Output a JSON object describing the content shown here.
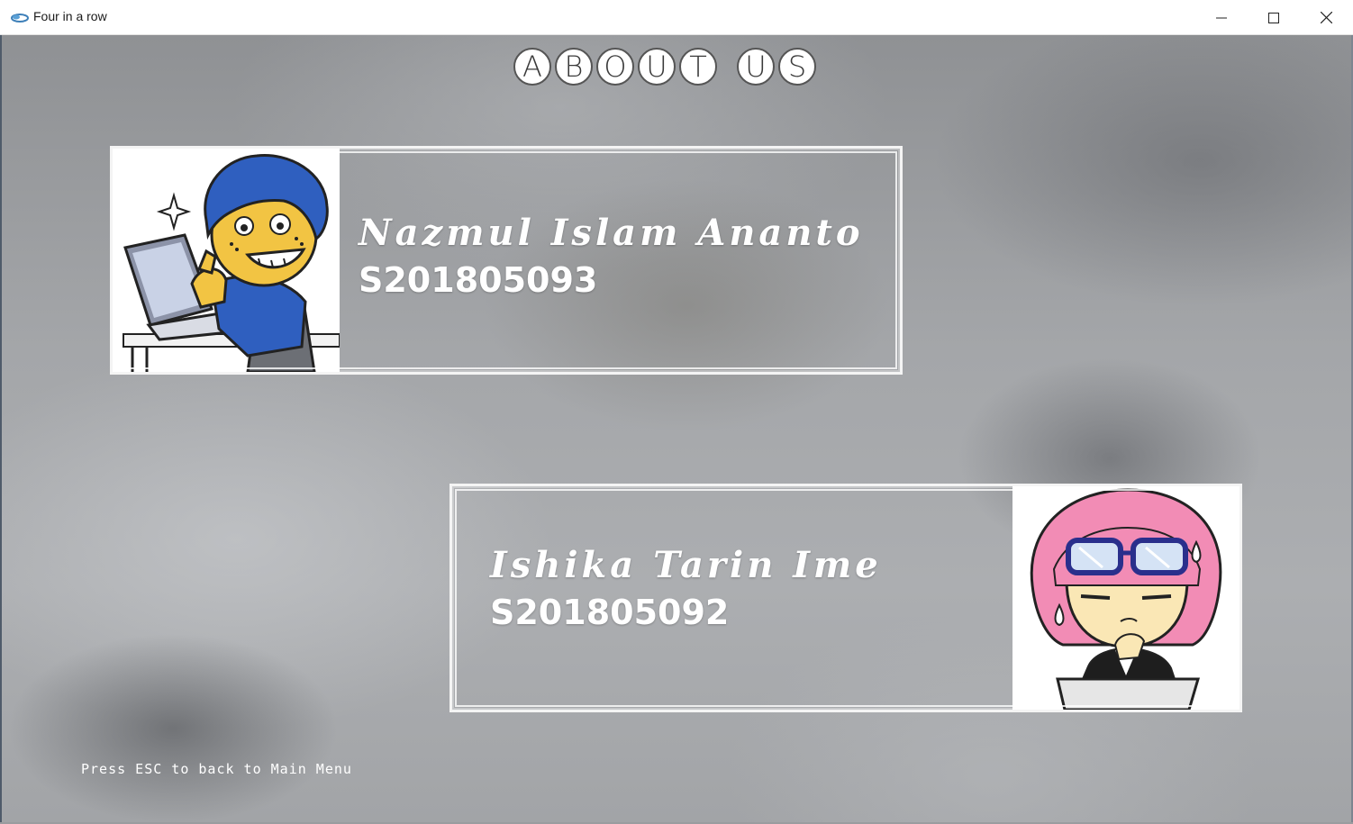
{
  "window": {
    "title": "Four in a row",
    "controls": {
      "minimize": "minimize-icon",
      "maximize": "maximize-icon",
      "close": "close-icon"
    }
  },
  "header": {
    "letters": [
      "A",
      "B",
      "O",
      "U",
      "T",
      "U",
      "S"
    ]
  },
  "members": [
    {
      "name": "Nazmul Islam Ananto",
      "id": "S201805093",
      "avatar": "boy-cartoon-avatar"
    },
    {
      "name": "Ishika Tarin Ime",
      "id": "S201805092",
      "avatar": "girl-cartoon-avatar"
    }
  ],
  "footer": {
    "hint": "Press ESC to back to Main Menu"
  },
  "colors": {
    "text": "#ffffff",
    "card_border": "#f4f4f4",
    "boy_hair": "#2f5fbf",
    "girl_hair": "#f28cb5"
  }
}
